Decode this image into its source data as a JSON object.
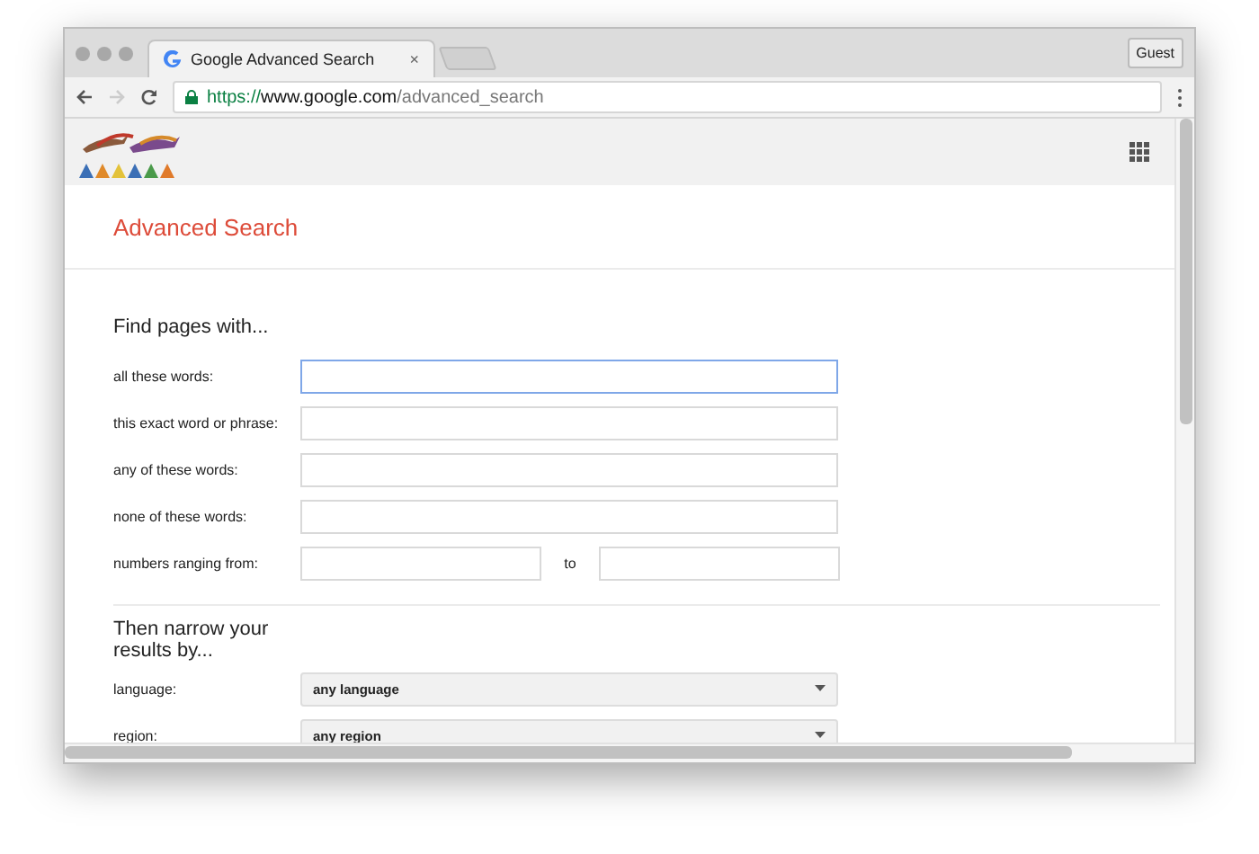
{
  "window": {
    "tab_title": "Google Advanced Search",
    "tab_close": "×",
    "profile_button": "Guest"
  },
  "address_bar": {
    "scheme": "https://",
    "host": "www.google.com",
    "path": "/advanced_search"
  },
  "page": {
    "title": "Advanced Search",
    "sections": [
      {
        "heading": "Find pages with...",
        "rows": [
          {
            "kind": "text",
            "label": "all these words:",
            "focused": true
          },
          {
            "kind": "text",
            "label": "this exact word or phrase:",
            "focused": false
          },
          {
            "kind": "text",
            "label": "any of these words:",
            "focused": false
          },
          {
            "kind": "text",
            "label": "none of these words:",
            "focused": false
          },
          {
            "kind": "range",
            "label": "numbers ranging from:",
            "separator": "to"
          }
        ]
      },
      {
        "heading": "Then narrow your results by...",
        "rows": [
          {
            "kind": "select",
            "label": "language:",
            "value": "any language"
          },
          {
            "kind": "select",
            "label": "region:",
            "value": "any region"
          }
        ]
      }
    ]
  }
}
